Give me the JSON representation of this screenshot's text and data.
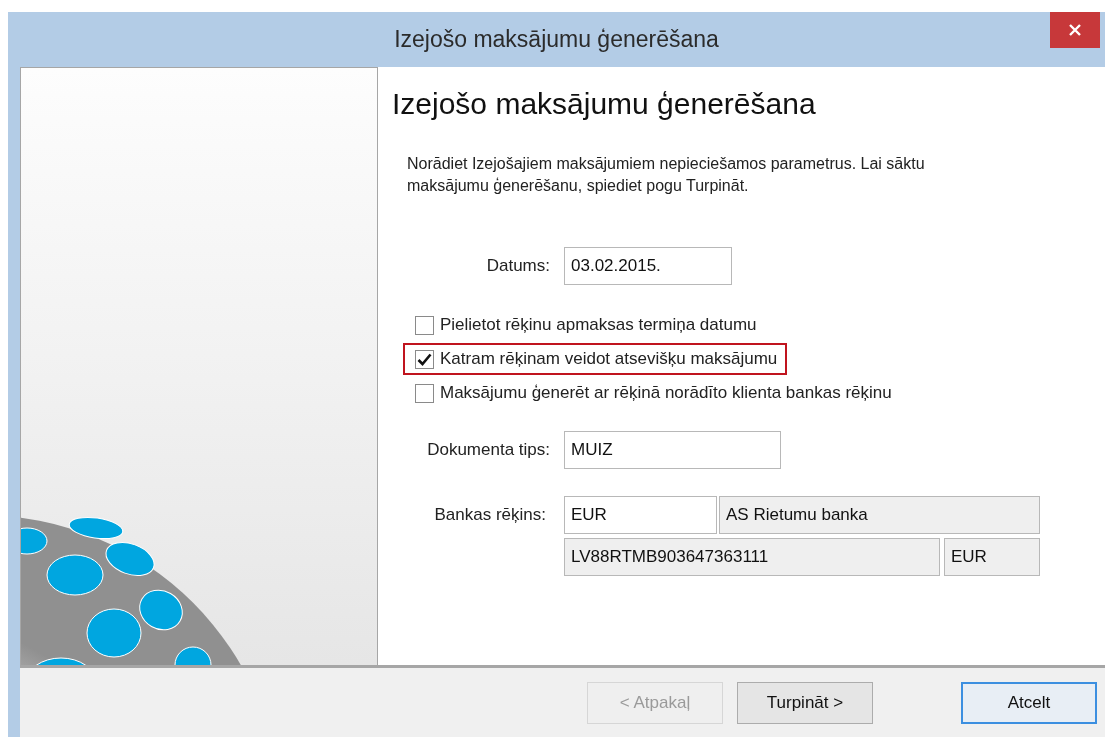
{
  "window": {
    "title": "Izejošo maksājumu ģenerēšana"
  },
  "page": {
    "heading": "Izejošo maksājumu ģenerēšana",
    "description": "Norādiet Izejošajiem maksājumiem nepieciešamos parametrus. Lai sāktu maksājumu ģenerēšanu, spiediet pogu Turpināt."
  },
  "date": {
    "label": "Datums:",
    "value": "03.02.2015."
  },
  "checkboxes": [
    {
      "label": "Pielietot rēķinu apmaksas termiņa datumu",
      "checked": false,
      "highlighted": false
    },
    {
      "label": "Katram rēķinam veidot atsevišķu maksājumu",
      "checked": true,
      "highlighted": true
    },
    {
      "label": "Maksājumu ģenerēt ar rēķinā norādīto klienta bankas rēķinu",
      "checked": false,
      "highlighted": false
    }
  ],
  "document_type": {
    "label": "Dokumenta tips:",
    "value": "MUIZ"
  },
  "bank_account": {
    "label": "Bankas rēķins:",
    "currency": "EUR",
    "bank": "AS Rietumu banka",
    "account": "LV88RTMB903647363111",
    "account_currency": "EUR"
  },
  "buttons": [
    {
      "label": "< Atpakaļ",
      "disabled": true,
      "default": false
    },
    {
      "label": "Turpināt >",
      "disabled": false,
      "default": false
    },
    {
      "label": "Atcelt",
      "disabled": false,
      "default": true
    }
  ]
}
